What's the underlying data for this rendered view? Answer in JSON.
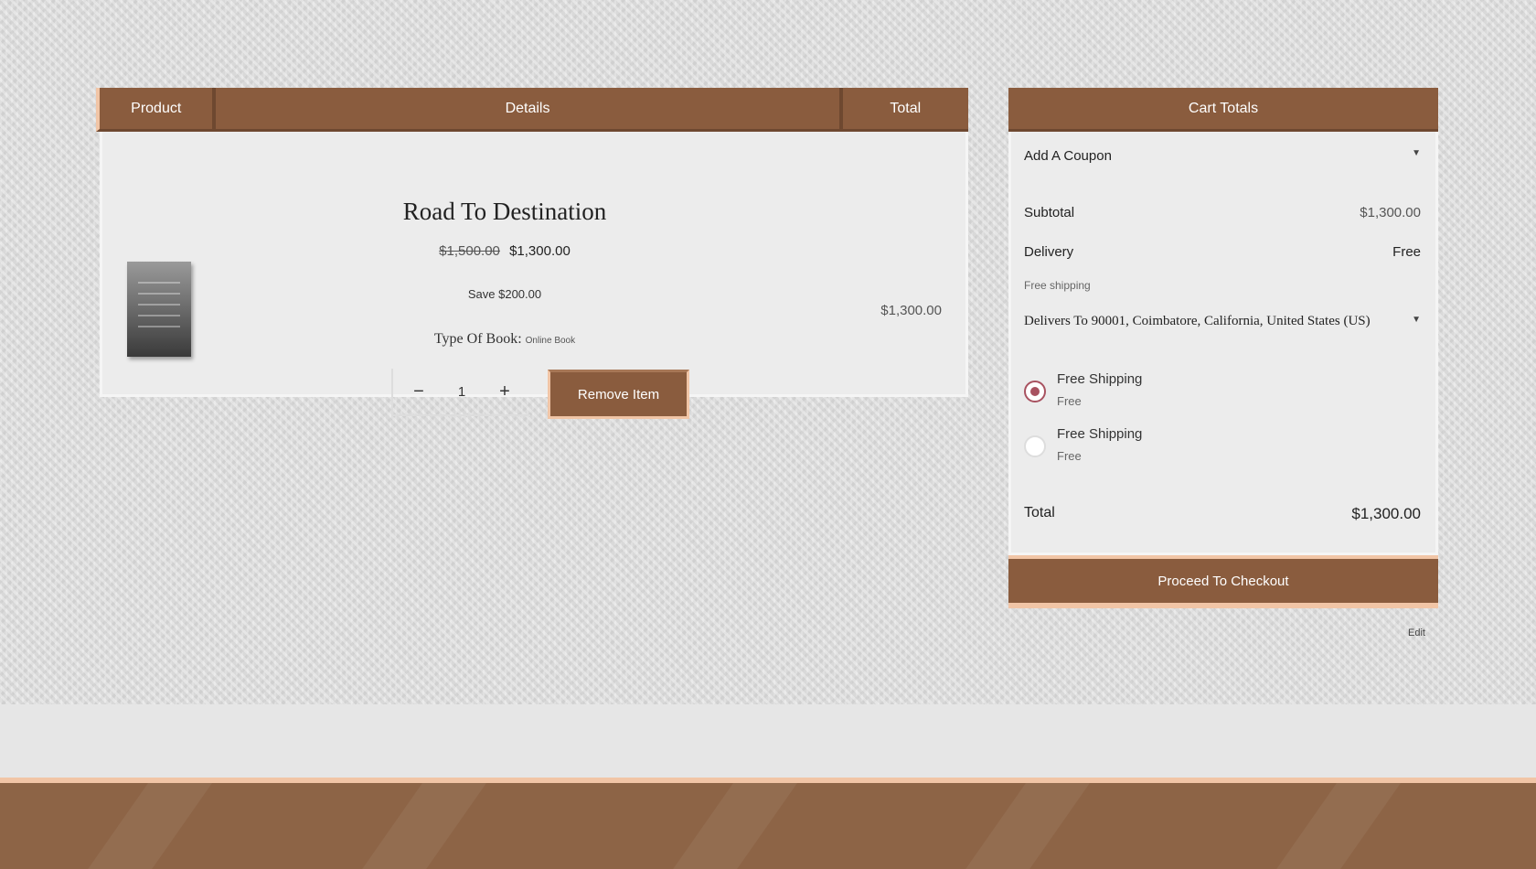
{
  "table": {
    "headers": {
      "product": "Product",
      "details": "Details",
      "total": "Total"
    },
    "item": {
      "title": "Road To Destination",
      "price_original": "$1,500.00",
      "price_sale": "$1,300.00",
      "save_text": "Save $200.00",
      "type_label": "Type Of Book:",
      "type_value": "Online Book",
      "quantity": "1",
      "minus_symbol": "−",
      "plus_symbol": "+",
      "remove_label": "Remove Item",
      "line_total": "$1,300.00"
    }
  },
  "totals": {
    "heading": "Cart Totals",
    "coupon_label": "Add A Coupon",
    "subtotal_label": "Subtotal",
    "subtotal_value": "$1,300.00",
    "delivery_label": "Delivery",
    "delivery_value": "Free",
    "shipping_note": "Free shipping",
    "delivers_to": "Delivers To 90001, Coimbatore, California, United States (US)",
    "options": [
      {
        "title": "Free Shipping",
        "sub": "Free",
        "checked": true
      },
      {
        "title": "Free Shipping",
        "sub": "Free",
        "checked": false
      }
    ],
    "total_label": "Total",
    "total_value": "$1,300.00",
    "checkout_label": "Proceed To Checkout",
    "edit_label": "Edit"
  },
  "colors": {
    "brand_brown": "#8a5c3e",
    "accent_peach": "#f1c5a6",
    "radio_accent": "#a85260"
  },
  "icons": [
    "chevron-down-icon",
    "minus-icon",
    "plus-icon",
    "radio-icon"
  ]
}
